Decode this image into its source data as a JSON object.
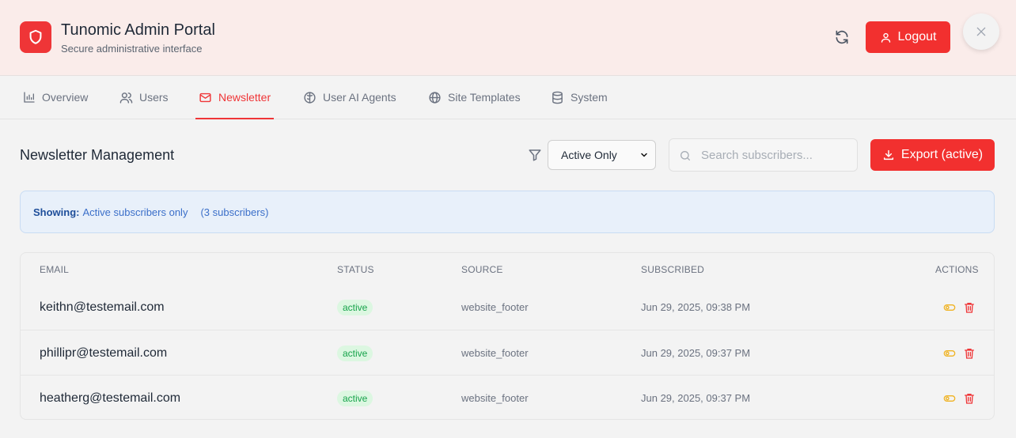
{
  "header": {
    "title": "Tunomic Admin Portal",
    "subtitle": "Secure administrative interface",
    "logout_label": "Logout"
  },
  "tabs": [
    {
      "label": "Overview",
      "icon": "bar-chart-icon"
    },
    {
      "label": "Users",
      "icon": "users-icon"
    },
    {
      "label": "Newsletter",
      "icon": "mail-icon",
      "active": true
    },
    {
      "label": "User AI Agents",
      "icon": "brain-icon"
    },
    {
      "label": "Site Templates",
      "icon": "globe-icon"
    },
    {
      "label": "System",
      "icon": "database-icon"
    }
  ],
  "newsletter": {
    "title": "Newsletter Management",
    "filter_selected": "Active Only",
    "search_placeholder": "Search subscribers...",
    "export_label": "Export (active)",
    "info_label": "Showing:",
    "info_value": "Active subscribers only",
    "info_count": "(3 subscribers)"
  },
  "table": {
    "columns": [
      "Email",
      "Status",
      "Source",
      "Subscribed",
      "Actions"
    ],
    "rows": [
      {
        "email": "keithn@testemail.com",
        "status": "active",
        "source": "website_footer",
        "subscribed": "Jun 29, 2025, 09:38 PM"
      },
      {
        "email": "phillipr@testemail.com",
        "status": "active",
        "source": "website_footer",
        "subscribed": "Jun 29, 2025, 09:37 PM"
      },
      {
        "email": "heatherg@testemail.com",
        "status": "active",
        "source": "website_footer",
        "subscribed": "Jun 29, 2025, 09:37 PM"
      }
    ]
  },
  "colors": {
    "accent": "#ef3537",
    "header_bg": "#faecea",
    "status_green": "#16a34a",
    "toggle_amber": "#f0b323",
    "info_blue": "#3b6fc9"
  }
}
